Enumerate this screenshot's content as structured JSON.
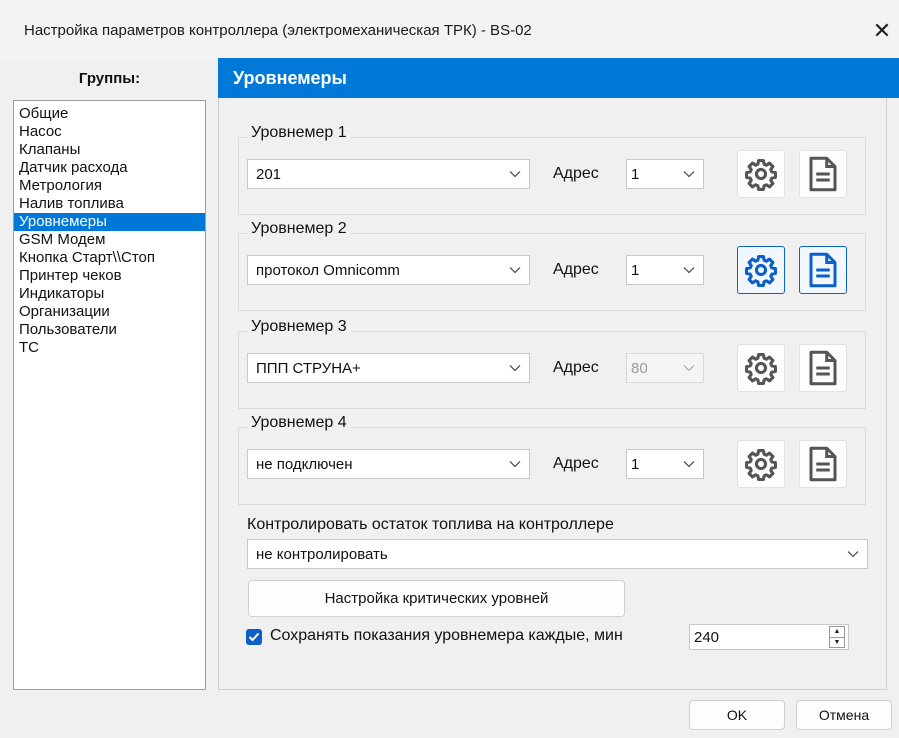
{
  "window": {
    "title": "Настройка параметров контроллера (электромеханическая ТРК) - BS-02",
    "close_symbol": "✕"
  },
  "groups": {
    "header": "Группы:",
    "items": [
      {
        "label": "Общие",
        "selected": false
      },
      {
        "label": "Насос",
        "selected": false
      },
      {
        "label": "Клапаны",
        "selected": false
      },
      {
        "label": "Датчик расхода",
        "selected": false
      },
      {
        "label": "Метрология",
        "selected": false
      },
      {
        "label": "Налив топлива",
        "selected": false
      },
      {
        "label": "Уровнемеры",
        "selected": true
      },
      {
        "label": "GSM Модем",
        "selected": false
      },
      {
        "label": "Кнопка Старт\\\\Стоп",
        "selected": false
      },
      {
        "label": "Принтер чеков",
        "selected": false
      },
      {
        "label": "Индикаторы",
        "selected": false
      },
      {
        "label": "Организации",
        "selected": false
      },
      {
        "label": "Пользователи",
        "selected": false
      },
      {
        "label": "ТС",
        "selected": false
      }
    ]
  },
  "section": {
    "title": "Уровнемеры"
  },
  "gauges": [
    {
      "label": "Уровнемер 1",
      "protocol": "201",
      "address_label": "Адрес",
      "address": "1",
      "address_enabled": true,
      "buttons_active": false
    },
    {
      "label": "Уровнемер 2",
      "protocol": "протокол Omnicomm",
      "address_label": "Адрес",
      "address": "1",
      "address_enabled": true,
      "buttons_active": true
    },
    {
      "label": "Уровнемер 3",
      "protocol": "ППП СТРУНА+",
      "address_label": "Адрес",
      "address": "80",
      "address_enabled": false,
      "buttons_active": false
    },
    {
      "label": "Уровнемер 4",
      "protocol": "не подключен",
      "address_label": "Адрес",
      "address": "1",
      "address_enabled": true,
      "buttons_active": false
    }
  ],
  "fuel_control": {
    "label": "Контролировать остаток топлива на контроллере",
    "value": "не контролировать"
  },
  "critical_button": "Настройка критических уровней",
  "save_interval": {
    "checked": true,
    "label": "Сохранять показания уровнемера каждые, мин",
    "value": "240"
  },
  "footer": {
    "ok": "OK",
    "cancel": "Отмена"
  },
  "colors": {
    "accent": "#0078d7",
    "active_icon": "#0a5fc8",
    "inactive_icon": "#555555"
  },
  "icons": {
    "settings": "gear-icon",
    "document": "document-icon"
  }
}
